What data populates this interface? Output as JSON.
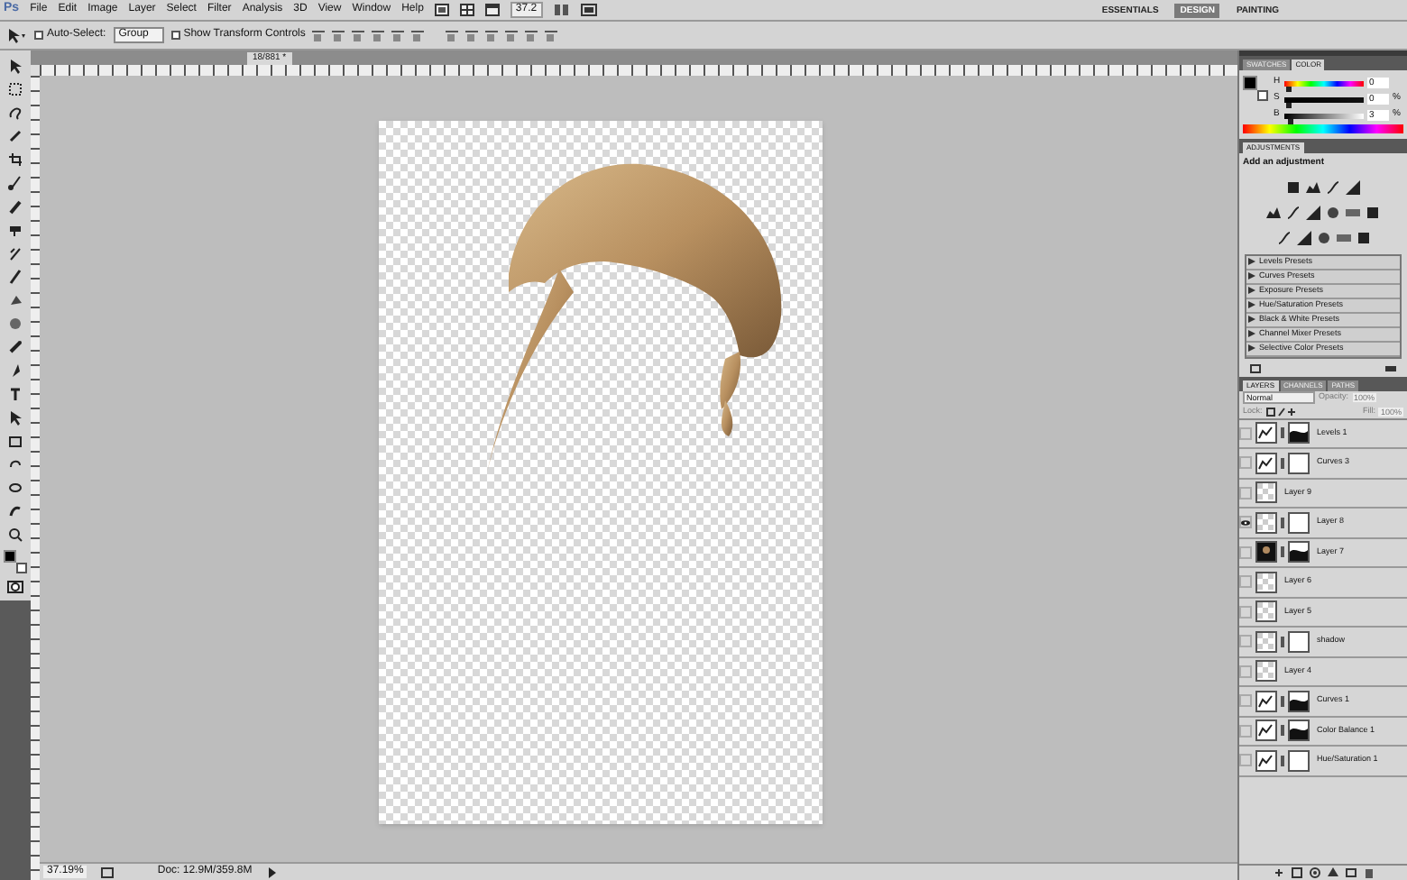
{
  "menu_bar": {
    "logo": "Ps",
    "items": [
      "File",
      "Edit",
      "Image",
      "Layer",
      "Select",
      "Filter",
      "Analysis",
      "3D",
      "View",
      "Window",
      "Help"
    ],
    "zoom": "37.2",
    "workspaces": [
      {
        "label": "ESSENTIALS",
        "selected": false
      },
      {
        "label": "DESIGN",
        "selected": true
      },
      {
        "label": "PAINTING",
        "selected": false
      }
    ]
  },
  "options_bar": {
    "auto_select": {
      "label": "Auto-Select:",
      "checked": false
    },
    "group": "Group",
    "show_transform": {
      "label": "Show Transform Controls",
      "checked": false
    }
  },
  "document": {
    "tab": "18/881 *"
  },
  "color_panel": {
    "tabs": [
      {
        "label": "SWATCHES",
        "selected": false
      },
      {
        "label": "COLOR",
        "selected": true
      }
    ],
    "sliders": [
      {
        "label": "H",
        "value": "0",
        "level": 0.03
      },
      {
        "label": "S",
        "value": "0",
        "unit": "%",
        "level": 0.03
      },
      {
        "label": "B",
        "value": "3",
        "unit": "%",
        "level": 0.05
      }
    ]
  },
  "adjustments_panel": {
    "title": "ADJUSTMENTS",
    "subtitle": "Add an adjustment",
    "presets": [
      {
        "label": "Levels Presets",
        "expanded": false
      },
      {
        "label": "Curves Presets",
        "expanded": false
      },
      {
        "label": "Exposure Presets",
        "expanded": false
      },
      {
        "label": "Hue/Saturation Presets",
        "expanded": false
      },
      {
        "label": "Black & White Presets",
        "expanded": false
      },
      {
        "label": "Channel Mixer Presets",
        "expanded": false
      },
      {
        "label": "Selective Color Presets",
        "expanded": false
      }
    ]
  },
  "layers_panel": {
    "tabs": [
      {
        "label": "LAYERS",
        "selected": true
      },
      {
        "label": "CHANNELS",
        "selected": false
      },
      {
        "label": "PATHS",
        "selected": false
      }
    ],
    "blend_mode": "Normal",
    "opacity_label": "Opacity:",
    "opacity": "100%",
    "lock_label": "Lock:",
    "fill_label": "Fill:",
    "fill": "100%",
    "layers": [
      {
        "name": "Levels 1",
        "visible": false,
        "kind": "adjustment",
        "mask": true,
        "mask_dark": true
      },
      {
        "name": "Curves 3",
        "visible": false,
        "kind": "adjustment",
        "mask": true,
        "mask_dark": false
      },
      {
        "name": "Layer 9",
        "visible": false,
        "kind": "pixel",
        "mask": false
      },
      {
        "name": "Layer 8",
        "visible": true,
        "kind": "pixel",
        "mask": true,
        "mask_dark": false
      },
      {
        "name": "Layer 7",
        "visible": false,
        "kind": "photo",
        "mask": true,
        "mask_dark": true
      },
      {
        "name": "Layer 6",
        "visible": false,
        "kind": "pixel",
        "mask": false
      },
      {
        "name": "Layer 5",
        "visible": false,
        "kind": "pixel",
        "mask": false
      },
      {
        "name": "shadow",
        "visible": false,
        "kind": "pixel",
        "mask": true,
        "mask_dark": false
      },
      {
        "name": "Layer 4",
        "visible": false,
        "kind": "pixel",
        "mask": false
      },
      {
        "name": "Curves 1",
        "visible": false,
        "kind": "adjustment",
        "mask": true,
        "mask_dark": true
      },
      {
        "name": "Color Balance 1",
        "visible": false,
        "kind": "adjustment",
        "mask": true,
        "mask_dark": true
      },
      {
        "name": "Hue/Saturation 1",
        "visible": false,
        "kind": "adjustment",
        "mask": true,
        "mask_dark": false
      }
    ]
  },
  "status_bar": {
    "zoom": "37.19%",
    "doc": "Doc: 12.9M/359.8M"
  }
}
